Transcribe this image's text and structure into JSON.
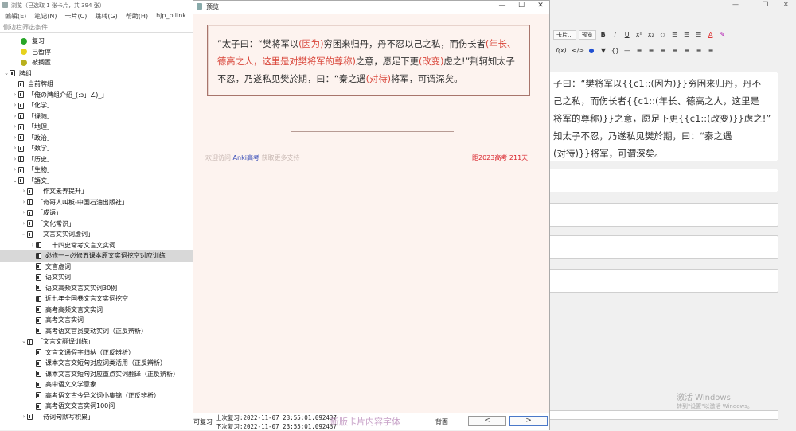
{
  "browser": {
    "title": "浏览（已选取 1 张卡片，共 394 张）",
    "menu": [
      "编辑(E)",
      "笔记(N)",
      "卡片(C)",
      "跳转(G)",
      "帮助(H)",
      "hjp_bilink"
    ],
    "filter_placeholder": "侧边栏筛选条件",
    "status_items": [
      {
        "label": "复习",
        "color": "#28a628"
      },
      {
        "label": "已暂停",
        "color": "#e6d21e"
      },
      {
        "label": "被搁置",
        "color": "#b8b01e"
      }
    ],
    "tree": [
      {
        "label": "牌组",
        "level": 0,
        "chevron": "v"
      },
      {
        "label": "当前牌组",
        "level": 1,
        "chevron": ""
      },
      {
        "label": "「俺の牌组介绍_(:з」∠)_」",
        "level": 1,
        "chevron": ">"
      },
      {
        "label": "「化学」",
        "level": 1,
        "chevron": ">"
      },
      {
        "label": "「课随」",
        "level": 1,
        "chevron": ">"
      },
      {
        "label": "「地理」",
        "level": 1,
        "chevron": ">"
      },
      {
        "label": "「政治」",
        "level": 1,
        "chevron": ">"
      },
      {
        "label": "「数学」",
        "level": 1,
        "chevron": ">"
      },
      {
        "label": "「历史」",
        "level": 1,
        "chevron": ">"
      },
      {
        "label": "「生物」",
        "level": 1,
        "chevron": ">"
      },
      {
        "label": "「語文」",
        "level": 1,
        "chevron": "v"
      },
      {
        "label": "「作文素养提升」",
        "level": 2,
        "chevron": ">"
      },
      {
        "label": "「奇哥人叫板-中国石油出版社」",
        "level": 2,
        "chevron": ">"
      },
      {
        "label": "「成语」",
        "level": 2,
        "chevron": ">"
      },
      {
        "label": "「文化常识」",
        "level": 2,
        "chevron": ">"
      },
      {
        "label": "「文言文实词虚词」",
        "level": 2,
        "chevron": "v"
      },
      {
        "label": "二十四史常考文言文实词",
        "level": 3,
        "chevron": ">"
      },
      {
        "label": "必修一~必修五课本原文实词挖空对应训练",
        "level": 3,
        "chevron": "",
        "selected": true
      },
      {
        "label": "文言虚词",
        "level": 3,
        "chevron": ""
      },
      {
        "label": "语文实词",
        "level": 3,
        "chevron": ""
      },
      {
        "label": "语文高频文言文实词30例",
        "level": 3,
        "chevron": ""
      },
      {
        "label": "近七年全国卷文言文实词挖空",
        "level": 3,
        "chevron": ""
      },
      {
        "label": "高考高频文言文实词",
        "level": 3,
        "chevron": ""
      },
      {
        "label": "高考文言实词",
        "level": 3,
        "chevron": ""
      },
      {
        "label": "高考语文官员变动实词（正反辨析）",
        "level": 3,
        "chevron": ""
      },
      {
        "label": "「文言文翻译训练」",
        "level": 2,
        "chevron": "v"
      },
      {
        "label": "文言文通假字归纳（正反辨析）",
        "level": 3,
        "chevron": ""
      },
      {
        "label": "课本文言文短句对应词类活用（正反辨析）",
        "level": 3,
        "chevron": ""
      },
      {
        "label": "课本文言文短句对应重点实词翻译（正反辨析）",
        "level": 3,
        "chevron": ""
      },
      {
        "label": "高中语文文学意象",
        "level": 3,
        "chevron": ""
      },
      {
        "label": "高考语文古今异义词小集锦（正反辨析）",
        "level": 3,
        "chevron": ""
      },
      {
        "label": "高考语文文言实词100问",
        "level": 3,
        "chevron": ""
      },
      {
        "label": "「诗词句默写积累」",
        "level": 2,
        "chevron": ">"
      }
    ]
  },
  "preview": {
    "title": "预览",
    "card_segments": [
      {
        "text": "”太子曰：“樊将军以",
        "red": false
      },
      {
        "text": "(因为)",
        "red": true
      },
      {
        "text": "穷困来归丹，丹不忍以己之私，而伤长者",
        "red": false
      },
      {
        "text": "(年长、德高之人，这里是对樊将军的尊称)",
        "red": true
      },
      {
        "text": "之意，愿足下更",
        "red": false
      },
      {
        "text": "(改变)",
        "red": true
      },
      {
        "text": "虑之!”荆轲知太子不忍，乃遂私见樊於期，曰：“秦之遇",
        "red": false
      },
      {
        "text": "(对待)",
        "red": true
      },
      {
        "text": "将军，可谓深矣。",
        "red": false
      }
    ],
    "footer": {
      "left_prefix": "欢迎访问 ",
      "left_link": "Anki高考",
      "left_suffix": " 获取更多支持",
      "right": "距2023高考 211天"
    },
    "bottom": {
      "review_label": "可复习",
      "last_review_1": "上次复习:2022-11-07 23:55:01.092437",
      "last_review_2": "下次复习:2022-11-07 23:55:01.092437",
      "overlay_text": "新版卡片内容字体",
      "back_label": "背面",
      "prev_label": "<",
      "next_label": ">"
    }
  },
  "editor": {
    "toolbar_buttons": [
      "卡片...",
      "预览"
    ],
    "format_icons": [
      "B",
      "I",
      "U",
      "x²",
      "x₂",
      "◇",
      "☰",
      "☰",
      "☰",
      "A",
      "✎"
    ],
    "format_icons2": [
      "f(x)",
      "</>",
      "●",
      "▼",
      "{}",
      "—",
      "≡",
      "≡",
      "≡",
      "≡",
      "≡",
      "≡",
      "≡"
    ],
    "field_text": "子曰：“樊将军以{{c1::(因为)}}穷困来归丹，丹不忍以己之私，而伤长者{{c1::(年长、德高之人，这里是对樊将军的尊称)}}之意，愿足下更{{c1::(改变)}}虑之!”荆轲知太子不忍，乃遂私见樊於期，曰：“秦之遇{{c1::(对待)}}将军，可谓深矣。",
    "field_display_lines": [
      "子曰：“樊将军以{{c1::(因为)}}穷困来归丹，丹不",
      "己之私，而伤长者{{c1::(年长、德高之人，这里是",
      "将军的尊称)}}之意，愿足下更{{c1::(改变)}}虑之!”",
      "知太子不忍，乃遂私见樊於期，曰：“秦之遇",
      "(对待)}}将军，可谓深矣。"
    ],
    "watermark_title": "激活 Windows",
    "watermark_sub": "转到\"设置\"以激活 Windows。"
  },
  "colors": {
    "accent_red": "#d9463a",
    "card_bg": "#fdf3ef",
    "card_border": "#a8756c",
    "link_blue": "#3b4fb8"
  }
}
